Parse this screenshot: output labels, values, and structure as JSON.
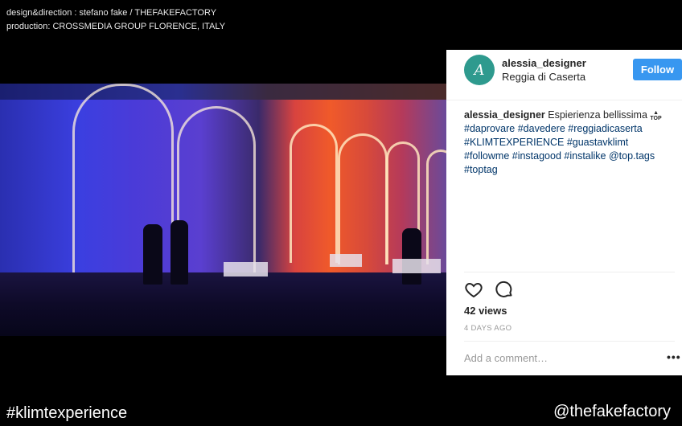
{
  "credits": {
    "line1": "design&direction : stefano fake / THEFAKEFACTORY",
    "line2": "production: CROSSMEDIA GROUP FLORENCE, ITALY"
  },
  "video": {
    "icon": "video-scene"
  },
  "post": {
    "username": "alessia_designer",
    "location": "Reggia di Caserta",
    "follow_label": "Follow",
    "caption_user": "alessia_designer",
    "caption_text": "Espierienza bellissima",
    "caption_emoji": "TOP",
    "hashtags_line1": "#daprovare #davedere #reggiadicaserta",
    "hashtags_line2": "#KLIMTEXPERIENCE #guastavklimt",
    "hashtags_line3": "#followme #instagood #instalike @top.tags",
    "hashtags_line4": "#toptag",
    "views": "42 views",
    "timestamp": "4 DAYS AGO",
    "comment_placeholder": "Add a comment…",
    "more": "•••"
  },
  "footer": {
    "hashtag": "#klimtexperience",
    "handle": "@thefakefactory"
  },
  "colors": {
    "follow_button": "#3897f0",
    "hashtag_link": "#003569",
    "avatar": "#2e9a8e"
  }
}
